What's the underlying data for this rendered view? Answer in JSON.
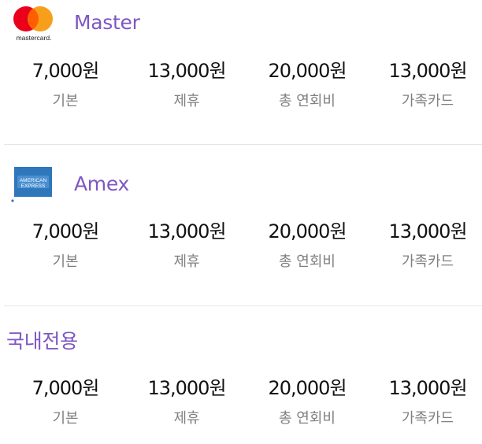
{
  "cards": [
    {
      "brand": "Master",
      "logo": "mastercard-logo",
      "logo_text": "mastercard.",
      "fees": [
        {
          "amount": "7,000원",
          "label": "기본"
        },
        {
          "amount": "13,000원",
          "label": "제휴"
        },
        {
          "amount": "20,000원",
          "label": "총 연회비"
        },
        {
          "amount": "13,000원",
          "label": "가족카드"
        }
      ]
    },
    {
      "brand": "Amex",
      "logo": "amex-logo",
      "logo_text": "AMERICAN EXPRESS",
      "fees": [
        {
          "amount": "7,000원",
          "label": "기본"
        },
        {
          "amount": "13,000원",
          "label": "제휴"
        },
        {
          "amount": "20,000원",
          "label": "총 연회비"
        },
        {
          "amount": "13,000원",
          "label": "가족카드"
        }
      ]
    },
    {
      "brand": "국내전용",
      "logo": "",
      "fees": [
        {
          "amount": "7,000원",
          "label": "기본"
        },
        {
          "amount": "13,000원",
          "label": "제휴"
        },
        {
          "amount": "20,000원",
          "label": "총 연회비"
        },
        {
          "amount": "13,000원",
          "label": "가족카드"
        }
      ]
    }
  ],
  "colors": {
    "brand_text": "#7e57c2",
    "amount_text": "#111111",
    "label_text": "#808080",
    "divider": "#e6e6e6",
    "mastercard_red": "#eb001b",
    "mastercard_orange": "#f79e1b",
    "amex_blue": "#2e77bb"
  }
}
